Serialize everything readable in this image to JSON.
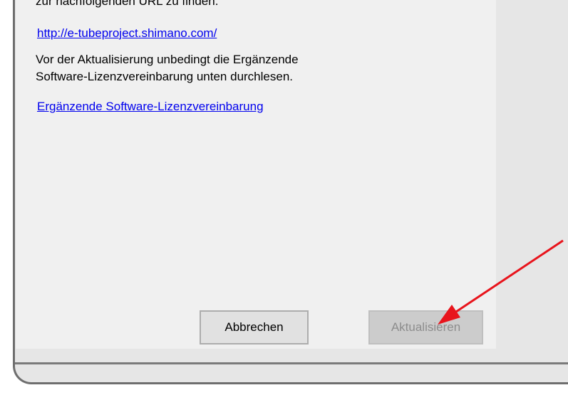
{
  "dialog": {
    "cut_text": "zur nachfolgenden URL zu finden.",
    "url_link": "http://e-tubeproject.shimano.com/",
    "notice_lines": [
      "Vor der Aktualisierung unbedingt die Ergänzende",
      "Software-Lizenzvereinbarung unten durchlesen."
    ],
    "license_link": "Ergänzende Software-Lizenzvereinbarung",
    "cancel_label": "Abbrechen",
    "update_label": "Aktualisieren"
  },
  "annotation": {
    "arrow_color": "#e8141c",
    "arrow_icon": "red-arrow-icon"
  },
  "colors": {
    "link": "#0000ee",
    "dialog_bg": "#f0f0f0",
    "disabled_text": "#8d8d8d"
  }
}
